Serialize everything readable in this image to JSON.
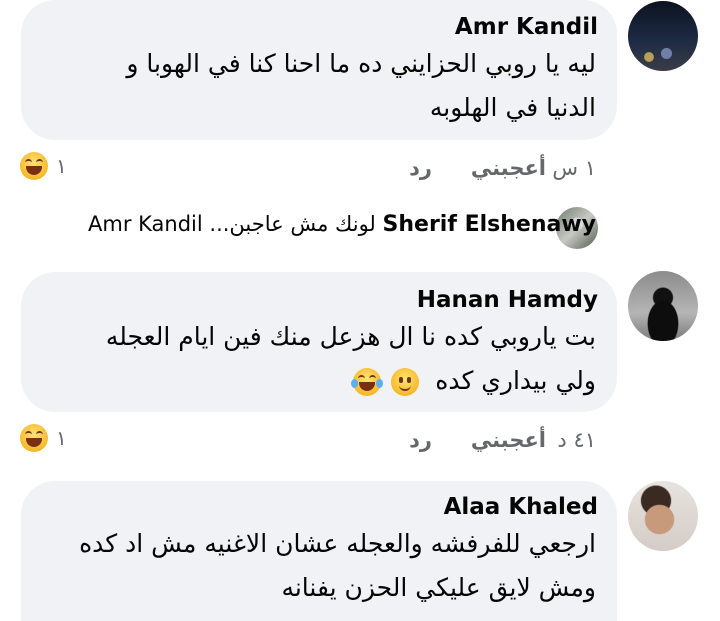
{
  "comments": [
    {
      "author": "Amr Kandil",
      "lines": [
        "ليه يا روبي الحزايني ده ما احنا كنا في الهوبا و",
        "الدنيا في الهلوبه"
      ],
      "time": "١ س",
      "like_label": "أعجبني",
      "reply_label": "رد",
      "reaction_count": "١",
      "reaction_icon": "laughing-emoji"
    },
    {
      "author": "Hanan Hamdy",
      "lines": [
        "بت ياروبي كده نا ال هزعل منك فين ايام العجله",
        "ولي بيداري كده"
      ],
      "time": "٤١ د",
      "like_label": "أعجبني",
      "reply_label": "رد",
      "reaction_count": "١",
      "reaction_icon": "laughing-emoji"
    },
    {
      "author": "Alaa Khaled",
      "lines": [
        "ارجعي للفرفشه والعجله عشان الاغنيه مش اد كده",
        "ومش لايق عليكي الحزن يفنانه"
      ]
    }
  ],
  "reply_preview": {
    "author": "Sherif Elshenawy",
    "text": "لونك مش عاجبن... Amr Kandil"
  },
  "colors": {
    "bubble": "#f0f2f5",
    "meta": "#65676b",
    "text": "#050505"
  }
}
